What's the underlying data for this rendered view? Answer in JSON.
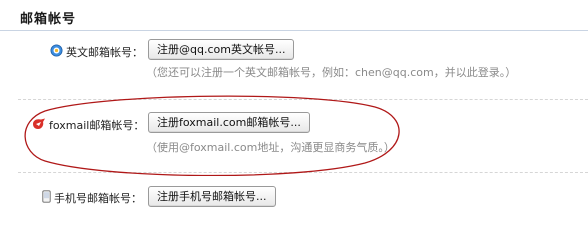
{
  "section": {
    "title": "邮箱帐号"
  },
  "accounts": {
    "english": {
      "label": "英文邮箱帐号：",
      "button": "注册@qq.com英文帐号...",
      "hint": "（您还可以注册一个英文邮箱帐号，例如：chen@qq.com，并以此登录。）",
      "icon": "qq-globe-icon"
    },
    "foxmail": {
      "label": "foxmail邮箱帐号：",
      "button": "注册foxmail.com邮箱帐号...",
      "hint": "（使用@foxmail.com地址，沟通更显商务气质。）",
      "icon": "foxmail-logo-icon"
    },
    "mobile": {
      "label": "手机号邮箱帐号：",
      "button": "注册手机号邮箱帐号...",
      "icon": "mobile-phone-icon"
    }
  },
  "colors": {
    "annotation_oval": "#b01818",
    "foxmail_brand": "#d9302a",
    "header_rule": "#c9d4e3"
  }
}
